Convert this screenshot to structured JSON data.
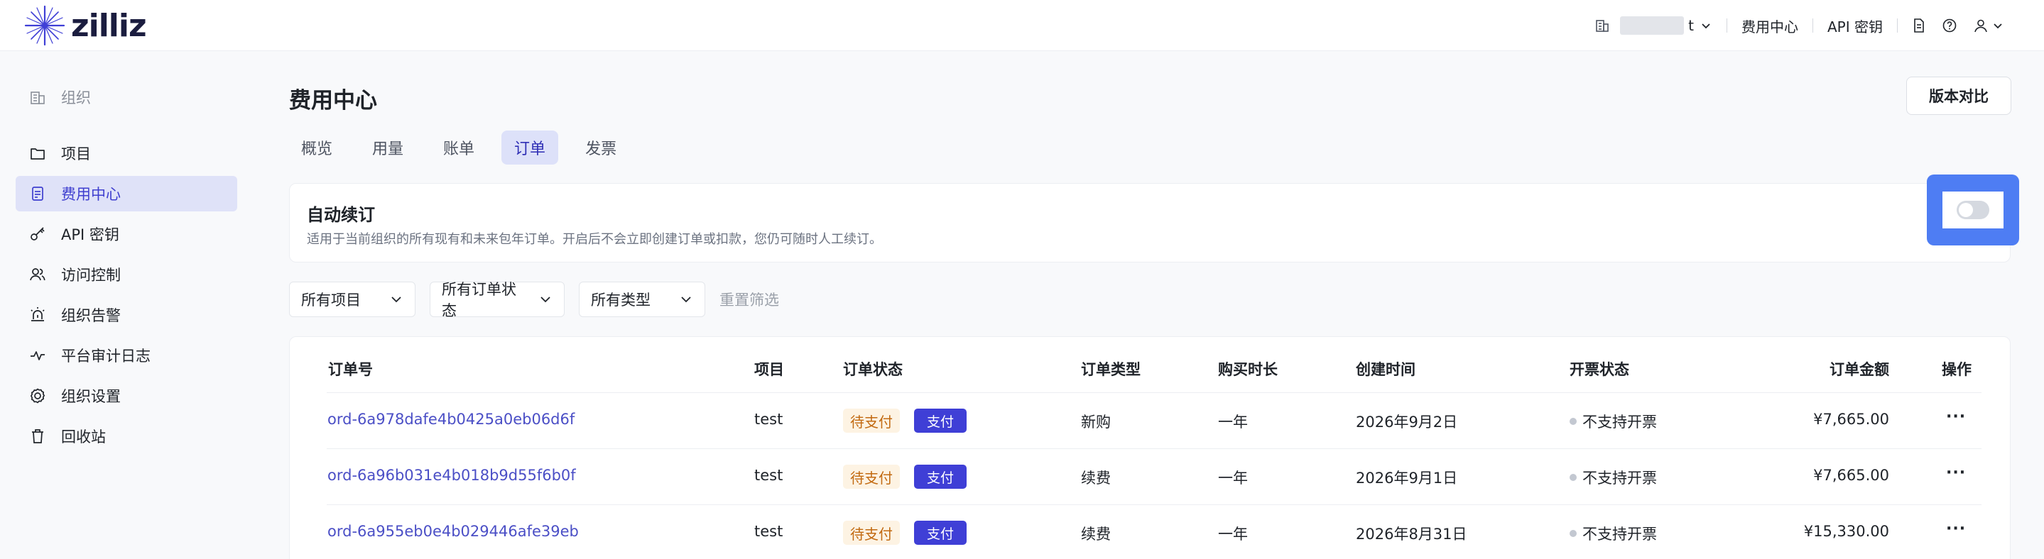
{
  "brand": {
    "name": "zilliz",
    "color": "#3f3fd6"
  },
  "topbar": {
    "org_suffix": "t",
    "billing_label": "费用中心",
    "api_key_label": "API 密钥",
    "icons": [
      "building-icon",
      "chevron-down-icon",
      "document-icon",
      "help-icon",
      "user-icon"
    ]
  },
  "sidebar": {
    "org_label": "组织",
    "items": [
      {
        "label": "项目",
        "icon": "folder-icon"
      },
      {
        "label": "费用中心",
        "icon": "billing-icon",
        "active": true
      },
      {
        "label": "API 密钥",
        "icon": "key-icon"
      },
      {
        "label": "访问控制",
        "icon": "users-icon"
      },
      {
        "label": "组织告警",
        "icon": "alarm-icon"
      },
      {
        "label": "平台审计日志",
        "icon": "pulse-icon"
      },
      {
        "label": "组织设置",
        "icon": "gear-icon"
      },
      {
        "label": "回收站",
        "icon": "trash-icon"
      }
    ]
  },
  "page": {
    "title": "费用中心",
    "compare_button": "版本对比",
    "tabs": [
      "概览",
      "用量",
      "账单",
      "订单",
      "发票"
    ],
    "active_tab": "订单"
  },
  "auto_renew": {
    "title": "自动续订",
    "description": "适用于当前组织的所有现有和未来包年订单。开启后不会立即创建订单或扣款，您仍可随时人工续订。",
    "enabled": false
  },
  "filters": {
    "project": "所有项目",
    "status": "所有订单状态",
    "type": "所有类型",
    "reset": "重置筛选"
  },
  "table": {
    "headers": [
      "订单号",
      "项目",
      "订单状态",
      "订单类型",
      "购买时长",
      "创建时间",
      "开票状态",
      "订单金额",
      "操作"
    ],
    "rows": [
      {
        "order_id": "ord-6a978dafe4b0425a0eb06d6f",
        "project": "test",
        "status": "待支付",
        "pay": "支付",
        "type": "新购",
        "duration": "一年",
        "created": "2026年9月2日",
        "invoice": "不支持开票",
        "amount": "¥7,665.00",
        "action": "···"
      },
      {
        "order_id": "ord-6a96b031e4b018b9d55f6b0f",
        "project": "test",
        "status": "待支付",
        "pay": "支付",
        "type": "续费",
        "duration": "一年",
        "created": "2026年9月1日",
        "invoice": "不支持开票",
        "amount": "¥7,665.00",
        "action": "···"
      },
      {
        "order_id": "ord-6a955eb0e4b029446afe39eb",
        "project": "test",
        "status": "待支付",
        "pay": "支付",
        "type": "续费",
        "duration": "一年",
        "created": "2026年8月31日",
        "invoice": "不支持开票",
        "amount": "¥15,330.00",
        "action": "···"
      }
    ]
  }
}
